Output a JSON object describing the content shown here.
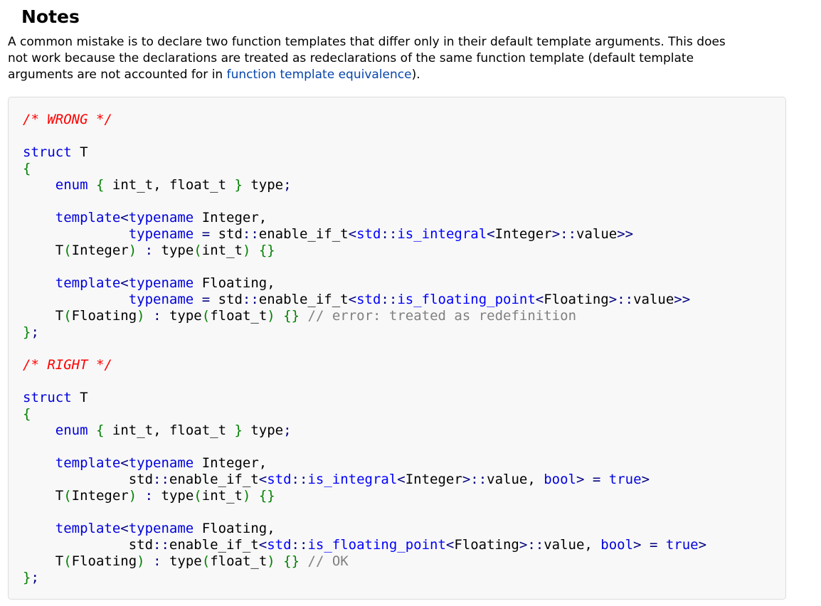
{
  "notes": {
    "heading": "Notes",
    "paragraph_lines": [
      "A common mistake is to declare two function templates that differ only in their default template arguments. This does",
      "not work because the declarations are treated as redeclarations of the same function template (default template",
      "arguments are not accounted for in "
    ],
    "link_text": "function template equivalence",
    "paragraph_end": ")."
  },
  "colors": {
    "link": "#0645ad",
    "code_background": "#f8f8f8",
    "code_border": "#dcdcdc",
    "comment_red": "#ff0000",
    "comment_gray": "#808080",
    "keyword": "#0000dd",
    "bracket": "#008000",
    "operator": "#000080"
  },
  "code_lines": [
    [
      {
        "t": "/* WRONG */",
        "c": "cm"
      }
    ],
    [],
    [
      {
        "t": "struct",
        "c": "kw"
      },
      {
        "t": " T",
        "c": "id"
      }
    ],
    [
      {
        "t": "{",
        "c": "br"
      }
    ],
    [
      {
        "t": "    ",
        "c": "id"
      },
      {
        "t": "enum",
        "c": "kw"
      },
      {
        "t": " ",
        "c": "id"
      },
      {
        "t": "{",
        "c": "br"
      },
      {
        "t": " int_t, float_t ",
        "c": "id"
      },
      {
        "t": "}",
        "c": "br"
      },
      {
        "t": " type",
        "c": "id"
      },
      {
        "t": ";",
        "c": "op"
      }
    ],
    [],
    [
      {
        "t": "    ",
        "c": "id"
      },
      {
        "t": "template",
        "c": "kw"
      },
      {
        "t": "<",
        "c": "op"
      },
      {
        "t": "typename",
        "c": "kw"
      },
      {
        "t": " Integer,",
        "c": "id"
      }
    ],
    [
      {
        "t": "             ",
        "c": "id"
      },
      {
        "t": "typename",
        "c": "kw"
      },
      {
        "t": " ",
        "c": "id"
      },
      {
        "t": "=",
        "c": "op"
      },
      {
        "t": " std",
        "c": "id"
      },
      {
        "t": "::",
        "c": "op"
      },
      {
        "t": "enable_if_t",
        "c": "id"
      },
      {
        "t": "<",
        "c": "op"
      },
      {
        "t": "std",
        "c": "ty"
      },
      {
        "t": "::",
        "c": "op"
      },
      {
        "t": "is_integral",
        "c": "ty"
      },
      {
        "t": "<",
        "c": "op"
      },
      {
        "t": "Integer",
        "c": "id"
      },
      {
        "t": ">::",
        "c": "op"
      },
      {
        "t": "value",
        "c": "id"
      },
      {
        "t": ">>",
        "c": "op"
      }
    ],
    [
      {
        "t": "    T",
        "c": "id"
      },
      {
        "t": "(",
        "c": "br"
      },
      {
        "t": "Integer",
        "c": "id"
      },
      {
        "t": ")",
        "c": "br"
      },
      {
        "t": " ",
        "c": "id"
      },
      {
        "t": ":",
        "c": "op"
      },
      {
        "t": " type",
        "c": "id"
      },
      {
        "t": "(",
        "c": "br"
      },
      {
        "t": "int_t",
        "c": "id"
      },
      {
        "t": ")",
        "c": "br"
      },
      {
        "t": " ",
        "c": "id"
      },
      {
        "t": "{}",
        "c": "br"
      }
    ],
    [],
    [
      {
        "t": "    ",
        "c": "id"
      },
      {
        "t": "template",
        "c": "kw"
      },
      {
        "t": "<",
        "c": "op"
      },
      {
        "t": "typename",
        "c": "kw"
      },
      {
        "t": " Floating,",
        "c": "id"
      }
    ],
    [
      {
        "t": "             ",
        "c": "id"
      },
      {
        "t": "typename",
        "c": "kw"
      },
      {
        "t": " ",
        "c": "id"
      },
      {
        "t": "=",
        "c": "op"
      },
      {
        "t": " std",
        "c": "id"
      },
      {
        "t": "::",
        "c": "op"
      },
      {
        "t": "enable_if_t",
        "c": "id"
      },
      {
        "t": "<",
        "c": "op"
      },
      {
        "t": "std",
        "c": "ty"
      },
      {
        "t": "::",
        "c": "op"
      },
      {
        "t": "is_floating_point",
        "c": "ty"
      },
      {
        "t": "<",
        "c": "op"
      },
      {
        "t": "Floating",
        "c": "id"
      },
      {
        "t": ">::",
        "c": "op"
      },
      {
        "t": "value",
        "c": "id"
      },
      {
        "t": ">>",
        "c": "op"
      }
    ],
    [
      {
        "t": "    T",
        "c": "id"
      },
      {
        "t": "(",
        "c": "br"
      },
      {
        "t": "Floating",
        "c": "id"
      },
      {
        "t": ")",
        "c": "br"
      },
      {
        "t": " ",
        "c": "id"
      },
      {
        "t": ":",
        "c": "op"
      },
      {
        "t": " type",
        "c": "id"
      },
      {
        "t": "(",
        "c": "br"
      },
      {
        "t": "float_t",
        "c": "id"
      },
      {
        "t": ")",
        "c": "br"
      },
      {
        "t": " ",
        "c": "id"
      },
      {
        "t": "{}",
        "c": "br"
      },
      {
        "t": " ",
        "c": "id"
      },
      {
        "t": "// error: treated as redefinition",
        "c": "cmg"
      }
    ],
    [
      {
        "t": "}",
        "c": "br"
      },
      {
        "t": ";",
        "c": "op"
      }
    ],
    [],
    [
      {
        "t": "/* RIGHT */",
        "c": "cm"
      }
    ],
    [],
    [
      {
        "t": "struct",
        "c": "kw"
      },
      {
        "t": " T",
        "c": "id"
      }
    ],
    [
      {
        "t": "{",
        "c": "br"
      }
    ],
    [
      {
        "t": "    ",
        "c": "id"
      },
      {
        "t": "enum",
        "c": "kw"
      },
      {
        "t": " ",
        "c": "id"
      },
      {
        "t": "{",
        "c": "br"
      },
      {
        "t": " int_t, float_t ",
        "c": "id"
      },
      {
        "t": "}",
        "c": "br"
      },
      {
        "t": " type",
        "c": "id"
      },
      {
        "t": ";",
        "c": "op"
      }
    ],
    [],
    [
      {
        "t": "    ",
        "c": "id"
      },
      {
        "t": "template",
        "c": "kw"
      },
      {
        "t": "<",
        "c": "op"
      },
      {
        "t": "typename",
        "c": "kw"
      },
      {
        "t": " Integer,",
        "c": "id"
      }
    ],
    [
      {
        "t": "             std",
        "c": "id"
      },
      {
        "t": "::",
        "c": "op"
      },
      {
        "t": "enable_if_t",
        "c": "id"
      },
      {
        "t": "<",
        "c": "op"
      },
      {
        "t": "std",
        "c": "ty"
      },
      {
        "t": "::",
        "c": "op"
      },
      {
        "t": "is_integral",
        "c": "ty"
      },
      {
        "t": "<",
        "c": "op"
      },
      {
        "t": "Integer",
        "c": "id"
      },
      {
        "t": ">::",
        "c": "op"
      },
      {
        "t": "value, ",
        "c": "id"
      },
      {
        "t": "bool",
        "c": "kw"
      },
      {
        "t": ">",
        "c": "op"
      },
      {
        "t": " ",
        "c": "id"
      },
      {
        "t": "=",
        "c": "op"
      },
      {
        "t": " ",
        "c": "id"
      },
      {
        "t": "true",
        "c": "kw"
      },
      {
        "t": ">",
        "c": "op"
      }
    ],
    [
      {
        "t": "    T",
        "c": "id"
      },
      {
        "t": "(",
        "c": "br"
      },
      {
        "t": "Integer",
        "c": "id"
      },
      {
        "t": ")",
        "c": "br"
      },
      {
        "t": " ",
        "c": "id"
      },
      {
        "t": ":",
        "c": "op"
      },
      {
        "t": " type",
        "c": "id"
      },
      {
        "t": "(",
        "c": "br"
      },
      {
        "t": "int_t",
        "c": "id"
      },
      {
        "t": ")",
        "c": "br"
      },
      {
        "t": " ",
        "c": "id"
      },
      {
        "t": "{}",
        "c": "br"
      }
    ],
    [],
    [
      {
        "t": "    ",
        "c": "id"
      },
      {
        "t": "template",
        "c": "kw"
      },
      {
        "t": "<",
        "c": "op"
      },
      {
        "t": "typename",
        "c": "kw"
      },
      {
        "t": " Floating,",
        "c": "id"
      }
    ],
    [
      {
        "t": "             std",
        "c": "id"
      },
      {
        "t": "::",
        "c": "op"
      },
      {
        "t": "enable_if_t",
        "c": "id"
      },
      {
        "t": "<",
        "c": "op"
      },
      {
        "t": "std",
        "c": "ty"
      },
      {
        "t": "::",
        "c": "op"
      },
      {
        "t": "is_floating_point",
        "c": "ty"
      },
      {
        "t": "<",
        "c": "op"
      },
      {
        "t": "Floating",
        "c": "id"
      },
      {
        "t": ">::",
        "c": "op"
      },
      {
        "t": "value, ",
        "c": "id"
      },
      {
        "t": "bool",
        "c": "kw"
      },
      {
        "t": ">",
        "c": "op"
      },
      {
        "t": " ",
        "c": "id"
      },
      {
        "t": "=",
        "c": "op"
      },
      {
        "t": " ",
        "c": "id"
      },
      {
        "t": "true",
        "c": "kw"
      },
      {
        "t": ">",
        "c": "op"
      }
    ],
    [
      {
        "t": "    T",
        "c": "id"
      },
      {
        "t": "(",
        "c": "br"
      },
      {
        "t": "Floating",
        "c": "id"
      },
      {
        "t": ")",
        "c": "br"
      },
      {
        "t": " ",
        "c": "id"
      },
      {
        "t": ":",
        "c": "op"
      },
      {
        "t": " type",
        "c": "id"
      },
      {
        "t": "(",
        "c": "br"
      },
      {
        "t": "float_t",
        "c": "id"
      },
      {
        "t": ")",
        "c": "br"
      },
      {
        "t": " ",
        "c": "id"
      },
      {
        "t": "{}",
        "c": "br"
      },
      {
        "t": " ",
        "c": "id"
      },
      {
        "t": "// OK",
        "c": "cmg"
      }
    ],
    [
      {
        "t": "}",
        "c": "br"
      },
      {
        "t": ";",
        "c": "op"
      }
    ]
  ]
}
